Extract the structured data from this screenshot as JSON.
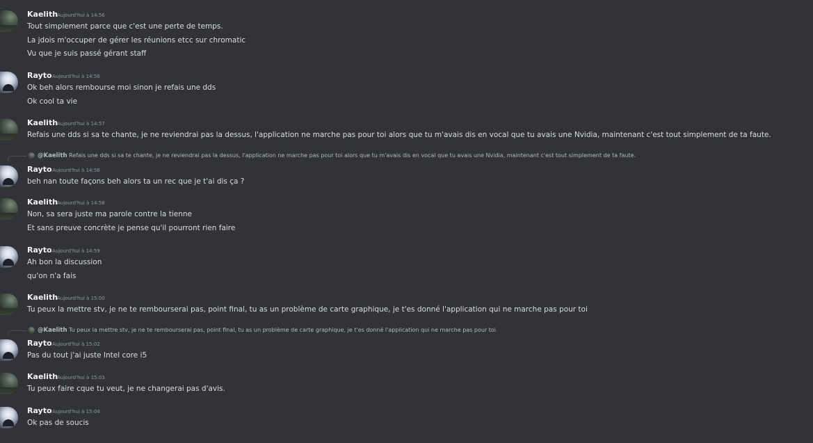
{
  "messages": [
    {
      "author": "Kaelith",
      "avatar": "kaelith",
      "timestamp": "Aujourd'hui à 14:56",
      "lines": [
        "Tout simplement parce que c'est une perte de temps.",
        "La jdois m'occuper de gérer les réunions etcc sur chromatic",
        "Vu que je suis passé gérant staff"
      ]
    },
    {
      "author": "Rayto",
      "avatar": "rayto",
      "timestamp": "Aujourd'hui à 14:56",
      "lines": [
        "Ok beh alors rembourse moi sinon je refais une dds",
        "Ok cool ta vie"
      ]
    },
    {
      "author": "Kaelith",
      "avatar": "kaelith",
      "timestamp": "Aujourd'hui à 14:57",
      "lines": [
        "Refais une dds si sa te chante, je ne reviendrai pas la dessus, l'application ne marche pas pour toi alors que tu m'avais dis en vocal que tu avais une Nvidia, maintenant c'est tout simplement de ta faute."
      ]
    },
    {
      "author": "Rayto",
      "avatar": "rayto",
      "timestamp": "Aujourd'hui à 14:58",
      "reply": {
        "author": "@Kaelith",
        "text": "Refais une dds si sa te chante, je ne reviendrai pas la dessus, l'application ne marche pas pour toi alors que tu m'avais dis en vocal que tu avais une Nvidia, maintenant c'est tout simplement de ta faute."
      },
      "lines": [
        "beh nan toute façons beh alors ta un rec que je t'ai dis ça ?"
      ]
    },
    {
      "author": "Kaelith",
      "avatar": "kaelith",
      "timestamp": "Aujourd'hui à 14:58",
      "lines": [
        "Non, sa sera juste ma parole contre la tienne",
        "Et sans preuve concrète je pense qu'il pourront rien faire"
      ]
    },
    {
      "author": "Rayto",
      "avatar": "rayto",
      "timestamp": "Aujourd'hui à 14:59",
      "lines": [
        "Ah bon la discussion",
        "qu'on n'a fais"
      ]
    },
    {
      "author": "Kaelith",
      "avatar": "kaelith",
      "timestamp": "Aujourd'hui à 15:00",
      "lines": [
        "Tu peux la mettre stv, je ne te rembourserai pas, point final, tu as un problème de carte graphique, je t'es donné l'application qui ne marche pas pour toi"
      ]
    },
    {
      "author": "Rayto",
      "avatar": "rayto",
      "timestamp": "Aujourd'hui à 15:02",
      "reply": {
        "author": "@Kaelith",
        "text": "Tu peux la mettre stv, je ne te rembourserai pas, point final, tu as un problème de carte graphique, je t'es donné l'application qui ne marche pas pour toi"
      },
      "lines": [
        "Pas du tout j'ai juste Intel core i5"
      ]
    },
    {
      "author": "Kaelith",
      "avatar": "kaelith",
      "timestamp": "Aujourd'hui à 15:03",
      "lines": [
        "Tu peux faire cque tu veut, je ne changerai pas d'avis."
      ]
    },
    {
      "author": "Rayto",
      "avatar": "rayto",
      "timestamp": "Aujourd'hui à 15:04",
      "lines": [
        "Ok pas de soucis"
      ]
    }
  ]
}
